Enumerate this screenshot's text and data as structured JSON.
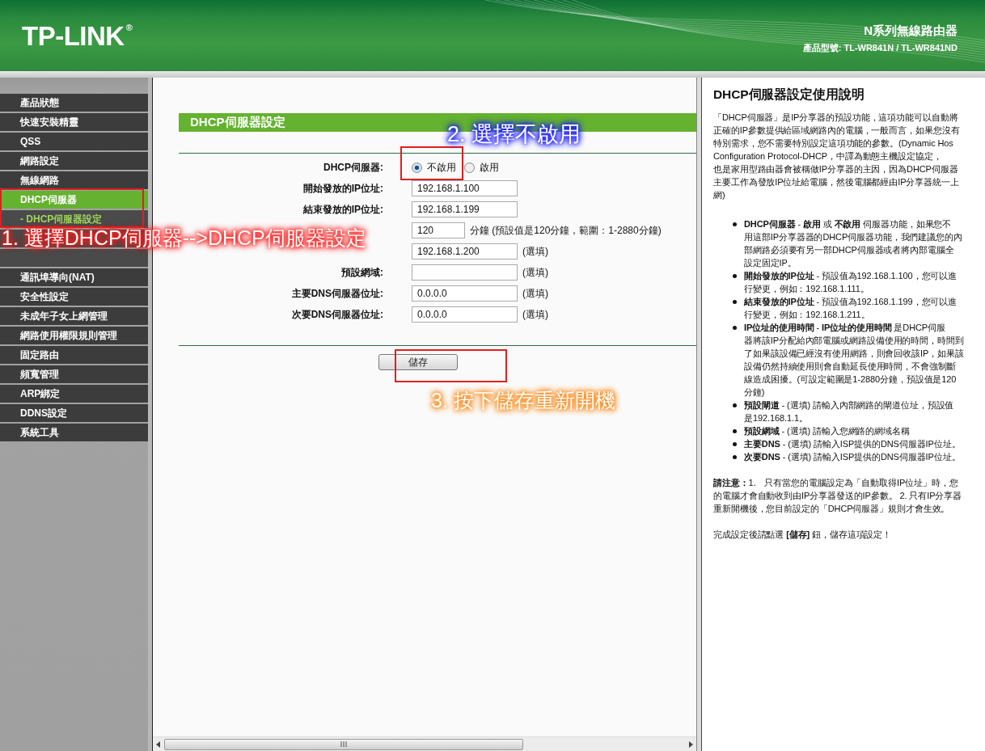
{
  "header": {
    "logo": "TP-LINK",
    "logo_mark": "®",
    "series": "N系列無線路由器",
    "model_label": "產品型號:",
    "model": "TL-WR841N / TL-WR841ND"
  },
  "sidebar": {
    "items": [
      {
        "label": "產品狀態",
        "kind": "main",
        "selected": false
      },
      {
        "label": "快速安裝精靈",
        "kind": "main",
        "selected": false
      },
      {
        "label": "QSS",
        "kind": "main",
        "selected": false
      },
      {
        "label": "網路設定",
        "kind": "main",
        "selected": false
      },
      {
        "label": "無線網路",
        "kind": "main",
        "selected": false
      },
      {
        "label": "DHCP伺服器",
        "kind": "main",
        "selected": true
      },
      {
        "label": "- DHCP伺服器設定",
        "kind": "sub",
        "selected": true
      },
      {
        "kind": "covered"
      },
      {
        "kind": "covered"
      },
      {
        "label": "通訊埠導向(NAT)",
        "kind": "main",
        "selected": false
      },
      {
        "label": "安全性設定",
        "kind": "main",
        "selected": false
      },
      {
        "label": "未成年子女上網管理",
        "kind": "main",
        "selected": false
      },
      {
        "label": "網路使用權限規則管理",
        "kind": "main",
        "selected": false
      },
      {
        "label": "固定路由",
        "kind": "main",
        "selected": false
      },
      {
        "label": "頻寬管理",
        "kind": "main",
        "selected": false
      },
      {
        "label": "ARP綁定",
        "kind": "main",
        "selected": false
      },
      {
        "label": "DDNS設定",
        "kind": "main",
        "selected": false
      },
      {
        "label": "系統工具",
        "kind": "main",
        "selected": false
      }
    ]
  },
  "form": {
    "title": "DHCP伺服器設定",
    "rows": [
      {
        "label": "DHCP伺服器:",
        "kind": "radio",
        "options": [
          {
            "label": "不啟用",
            "selected": true
          },
          {
            "label": "啟用",
            "selected": false
          }
        ]
      },
      {
        "label": "開始發放的IP位址:",
        "kind": "input",
        "value": "192.168.1.100"
      },
      {
        "label": "結束發放的IP位址:",
        "kind": "input",
        "value": "192.168.1.199"
      },
      {
        "kind": "short",
        "value": "120",
        "note": "分鐘 (預設值是120分鐘，範圍：1-2880分鐘)"
      },
      {
        "kind": "input",
        "value": "192.168.1.200",
        "note": "(選填)"
      },
      {
        "label": "預設網域:",
        "kind": "input",
        "note": "(選填)"
      },
      {
        "label": "主要DNS伺服器位址:",
        "kind": "input",
        "value": "0.0.0.0",
        "note": "(選填)"
      },
      {
        "label": "次要DNS伺服器位址:",
        "kind": "input",
        "value": "0.0.0.0",
        "note": "(選填)"
      }
    ],
    "save": "儲存"
  },
  "help": {
    "title": "DHCP伺服器設定使用說明",
    "intro": [
      "「DHCP伺服器」是IP分享器的預設功能，這項功能可以自動將",
      "正確的IP參數提供給區域網路內的電腦，一般而言，如果您沒有",
      "特別需求，您不需要特別設定這項功能的參數。(Dynamic Hos",
      "Configuration Protocol-DHCP，中譯為動態主機設定協定，",
      "也是家用型路由器會被稱做IP分享器的主因，因為DHCP伺服器",
      "主要工作為發放IP位址給電腦，然後電腦都經由IP分享器統一上",
      "網)"
    ],
    "bullets": [
      [
        "**DHCP伺服器** - **啟用** 或 **不啟用** 伺服器功能，如果您不",
        "用這部IP分享器器的DHCP伺服器功能，我們建議您的內",
        "部網路必須要有另一部DHCP伺服器或者將內部電腦全",
        "設定固定IP。"
      ],
      [
        "**開始發放的IP位址** - 預設值為192.168.1.100，您可以進",
        "行變更，例如：192.168.1.111。"
      ],
      [
        "**結束發放的IP位址** - 預設值為192.168.1.199，您可以進",
        "行變更，例如：192.168.1.211。"
      ],
      [
        "**IP位址的使用時間** - **IP位址的使用時間** 是DHCP伺服",
        "器將該IP分配給內部電腦或網路設備使用的時間，時間到",
        "了如果該設備已經沒有使用網路，則會回收該IP，如果該",
        "設備仍然持續使用則會自動延長使用時間，不會強制斷",
        "線造成困擾。(可設定範圍是1-2880分鐘，預設值是120",
        "分鐘)"
      ],
      [
        "**預設閘道** - (選填) 請輸入內部網路的閘道位址，預設值",
        "是192.168.1.1。"
      ],
      [
        "**預設網域** - (選填) 請輸入您網路的網域名稱"
      ],
      [
        "**主要DNS** - (選填) 請輸入ISP提供的DNS伺服器IP位址。"
      ],
      [
        "**次要DNS** - (選填) 請輸入ISP提供的DNS伺服器IP位址。"
      ]
    ],
    "note": [
      "**請注意：**1.　只有當您的電腦設定為「自動取得IP位址」時，您",
      "的電腦才會自動收到由IP分享器發送的IP參數。 2. 只有IP分享器",
      "重新開機後，您目前設定的「DHCP伺服器」規則才會生效。"
    ],
    "footer": "完成設定後請點選 **[儲存]** 鈕，儲存這項設定！"
  },
  "annotations": [
    {
      "text": "1. 選擇DHCP伺服器-->DHCP伺服器設定",
      "kind": "red"
    },
    {
      "text": "2. 選擇不啟用",
      "kind": "blue"
    },
    {
      "text": "3. 按下儲存重新開機",
      "kind": "orange"
    }
  ]
}
